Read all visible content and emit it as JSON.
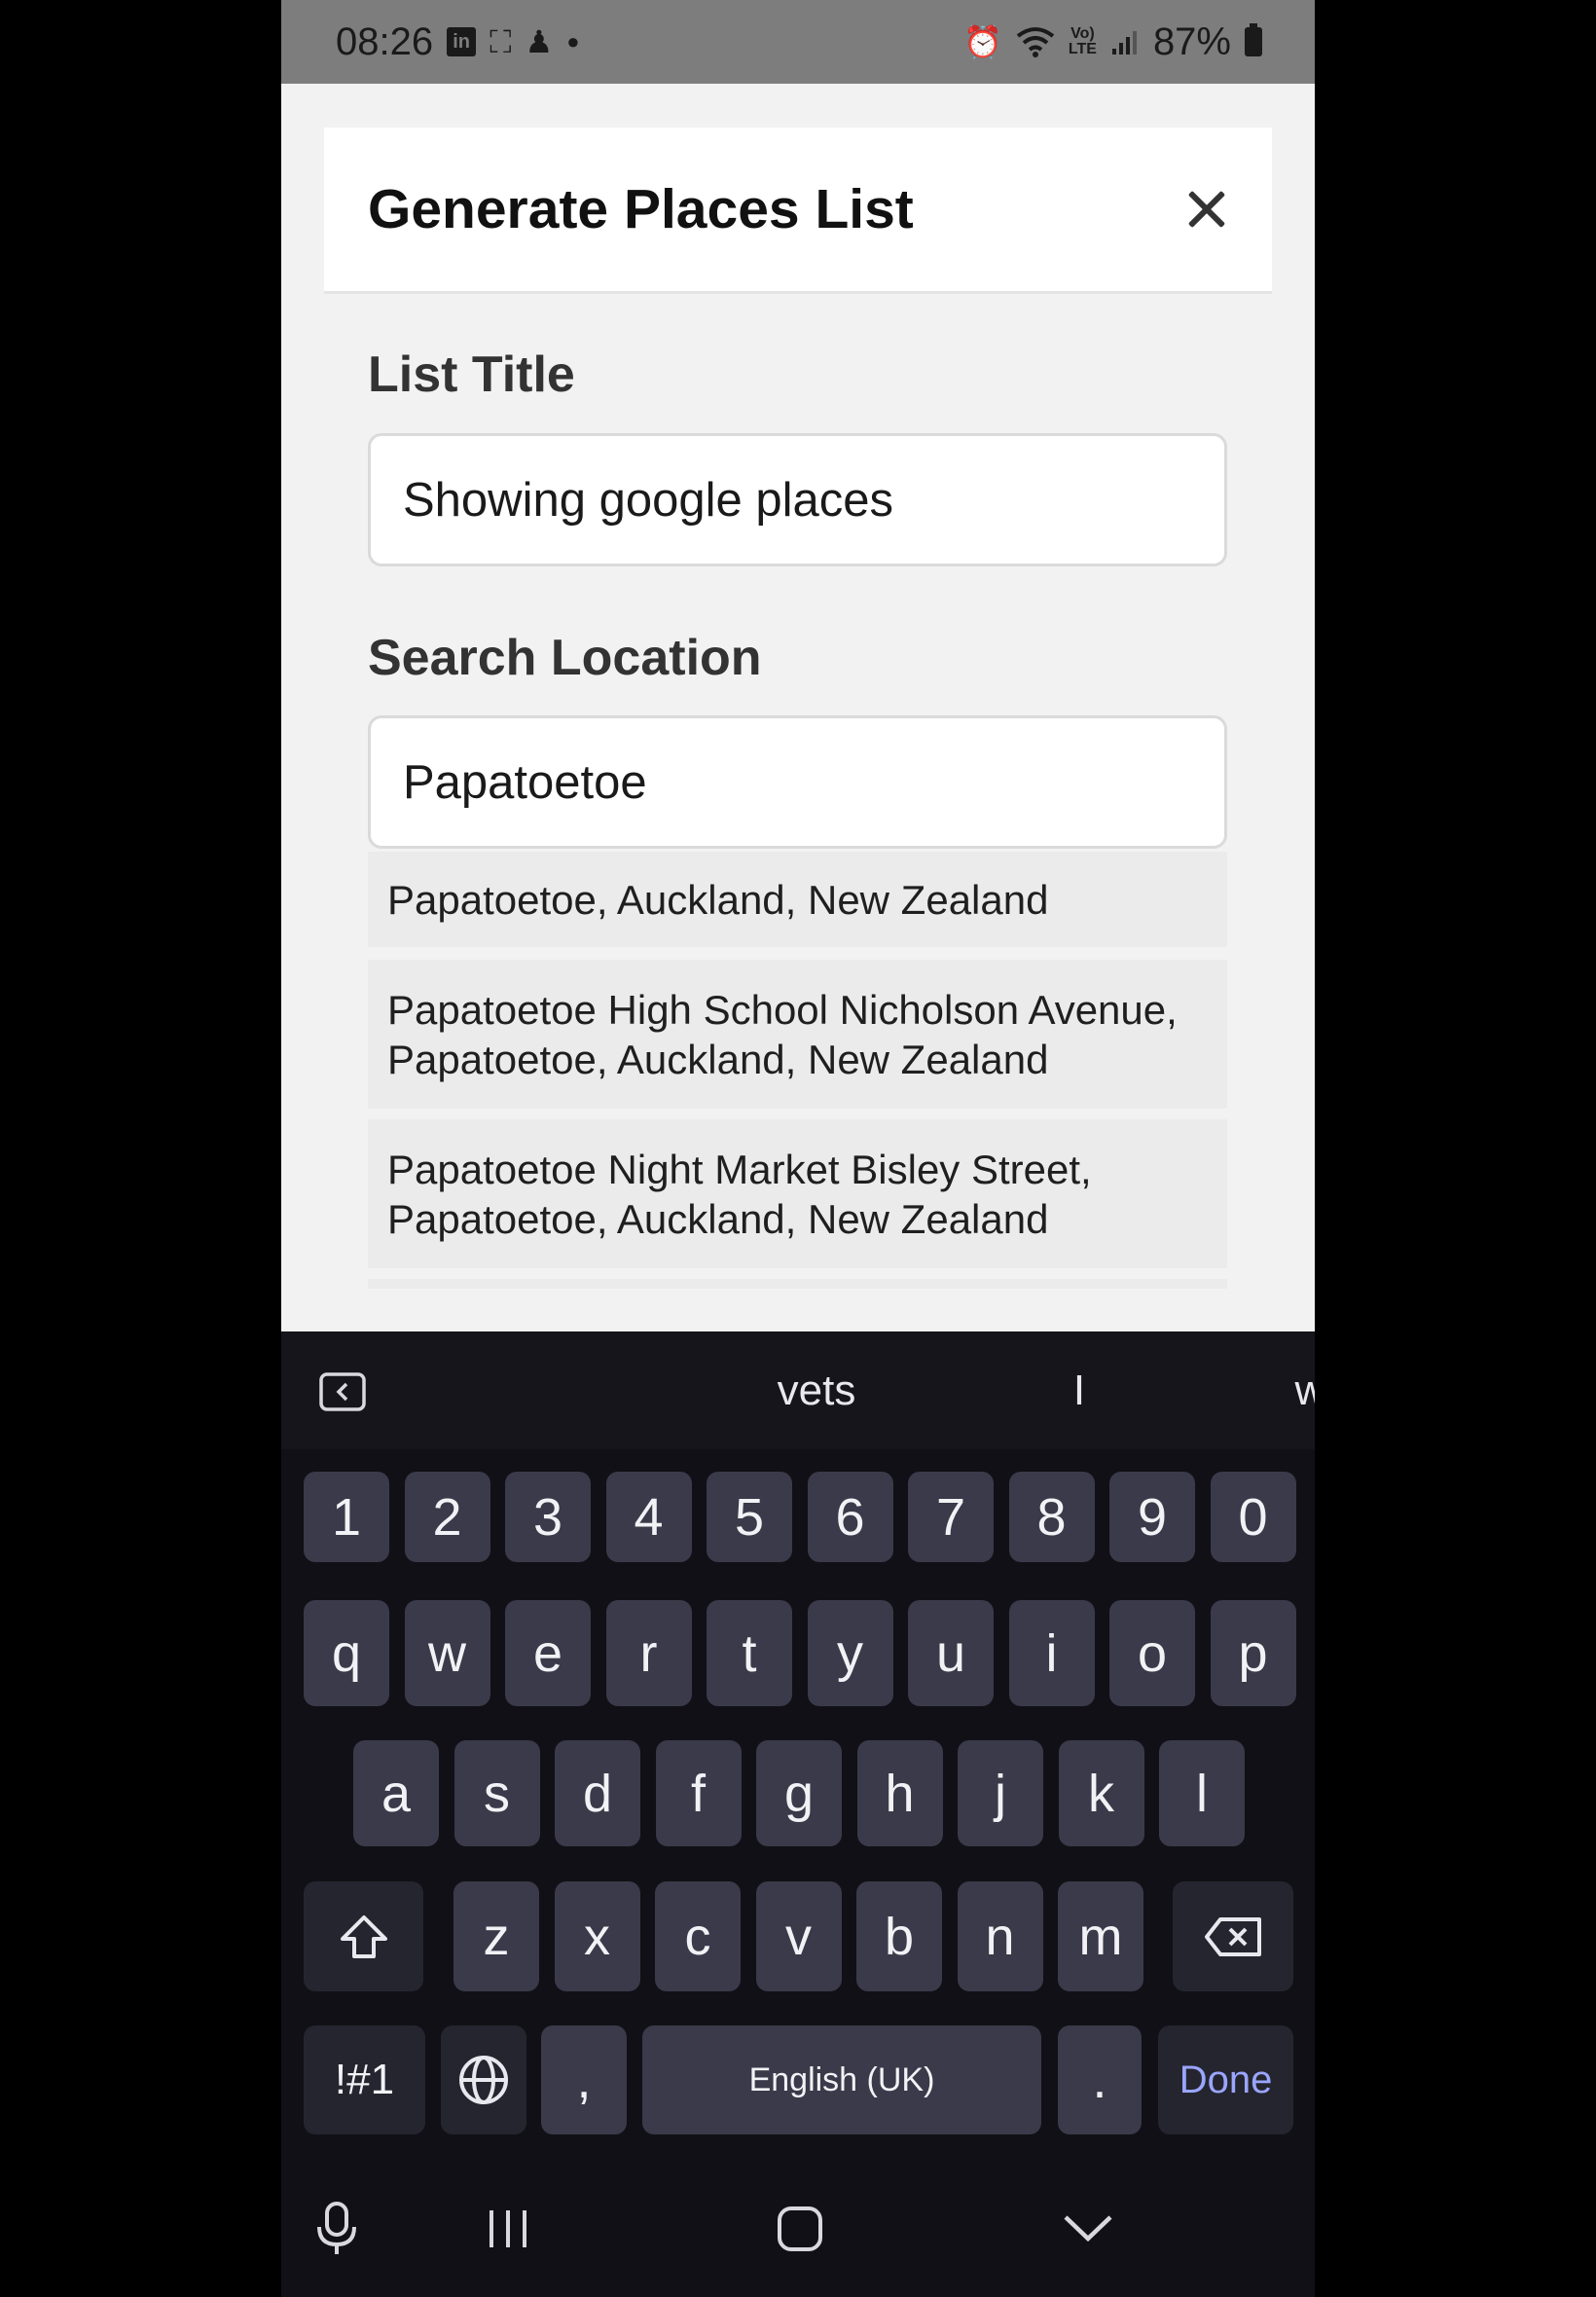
{
  "status_bar": {
    "time": "08:26",
    "left_icons": [
      "linkedin-icon",
      "screenshot-icon",
      "snapchat-icon",
      "dot-icon"
    ],
    "right_icons": [
      "alarm-icon",
      "wifi-icon",
      "volte-icon",
      "signal-icon"
    ],
    "battery": "87%"
  },
  "modal": {
    "title": "Generate Places List",
    "list_title_label": "List Title",
    "list_title_value": "Showing google places",
    "search_label": "Search Location",
    "search_value": "Papatoetoe",
    "suggestions": [
      {
        "line1": "Papatoetoe, Auckland, New Zealand",
        "line2": ""
      },
      {
        "line1": "Papatoetoe High School Nicholson Avenue,",
        "line2": "Papatoetoe, Auckland, New Zealand"
      },
      {
        "line1": "Papatoetoe Night Market Bisley Street,",
        "line2": "Papatoetoe, Auckland, New Zealand"
      }
    ]
  },
  "keyboard": {
    "suggestions": [
      "vets",
      "I",
      "what"
    ],
    "more": "···",
    "row_numbers": [
      "1",
      "2",
      "3",
      "4",
      "5",
      "6",
      "7",
      "8",
      "9",
      "0"
    ],
    "row_1": [
      "q",
      "w",
      "e",
      "r",
      "t",
      "y",
      "u",
      "i",
      "o",
      "p"
    ],
    "row_2": [
      "a",
      "s",
      "d",
      "f",
      "g",
      "h",
      "j",
      "k",
      "l"
    ],
    "row_3": [
      "z",
      "x",
      "c",
      "v",
      "b",
      "n",
      "m"
    ],
    "symbols_key": "!#1",
    "comma_key": ",",
    "space_key": "English (UK)",
    "period_key": ".",
    "done_key": "Done",
    "colors": {
      "done": "#9aa6ff",
      "key": "#3a3a4a",
      "background": "#111016"
    }
  },
  "nav_bar": {
    "icons": [
      "microphone-icon",
      "recent-apps-icon",
      "home-icon",
      "hide-keyboard-icon"
    ]
  }
}
